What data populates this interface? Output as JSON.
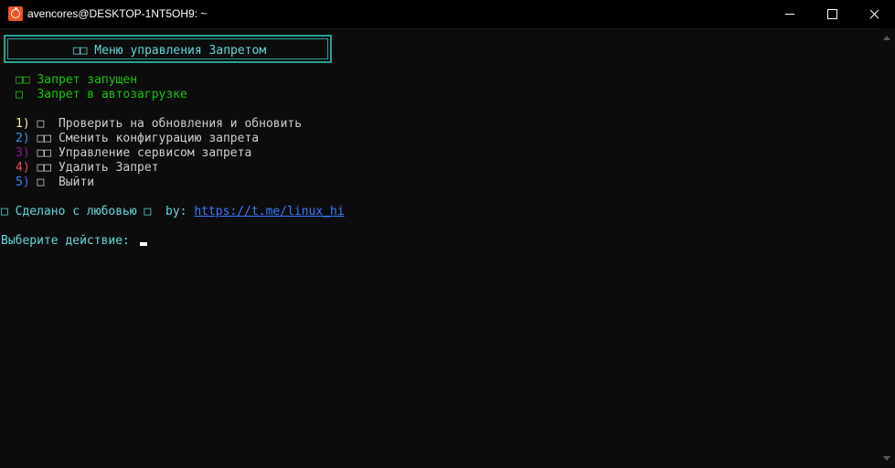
{
  "window": {
    "title": "avencores@DESKTOP-1NT5OH9: ~"
  },
  "header": {
    "menu_title": "□□ Меню управления Запретом"
  },
  "status": {
    "running": "□□ Запрет запущен",
    "autostart": "□  Запрет в автозагрузке"
  },
  "menu": {
    "items": [
      {
        "num": "1)",
        "icon": " □  ",
        "label": "Проверить на обновления и обновить"
      },
      {
        "num": "2)",
        "icon": " □□ ",
        "label": "Сменить конфигурацию запрета"
      },
      {
        "num": "3)",
        "icon": " □□ ",
        "label": "Управление сервисом запрета"
      },
      {
        "num": "4)",
        "icon": " □□ ",
        "label": "Удалить Запрет"
      },
      {
        "num": "5)",
        "icon": " □  ",
        "label": "Выйти"
      }
    ]
  },
  "footer": {
    "made_with": "□ Сделано с любовью □  by: ",
    "link": "https://t.me/linux_hi"
  },
  "prompt": {
    "text": "Выберите действие: "
  },
  "colors": {
    "background": "#0c0c0c",
    "green": "#16c60c",
    "cyan": "#61d6d6",
    "link": "#3b78ff"
  }
}
